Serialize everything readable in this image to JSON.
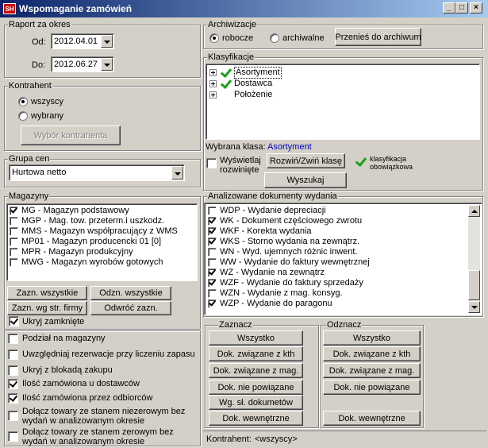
{
  "window": {
    "title": "Wspomaganie zamówień",
    "icon_text": "SH"
  },
  "raport": {
    "title": "Raport za okres",
    "od_label": "Od:",
    "od_value": "2012.04.01",
    "do_label": "Do:",
    "do_value": "2012.06.27"
  },
  "kontrahent": {
    "title": "Kontrahent",
    "opt_all": "wszyscy",
    "opt_sel": "wybrany",
    "btn_wybor": "Wybór kontrahenta"
  },
  "grupa_cen": {
    "title": "Grupa cen",
    "value": "Hurtowa netto"
  },
  "magazyny": {
    "title": "Magazyny",
    "items": [
      {
        "label": "MG - Magazyn podstawowy",
        "checked": true
      },
      {
        "label": "MGP - Mag. tow. przeterm.i uszkodz.",
        "checked": false
      },
      {
        "label": "MMS - Magazyn współpracujący z WMS",
        "checked": false
      },
      {
        "label": "MP01 - Magazyn producencki 01 [0]",
        "checked": false
      },
      {
        "label": "MPR - Magazyn produkcyjny",
        "checked": false
      },
      {
        "label": "MWG - Magazyn wyrobów gotowych",
        "checked": false
      }
    ],
    "btn_zazn_all": "Zazn. wszystkie",
    "btn_odzn_all": "Odzn. wszystkie",
    "btn_zazn_firmy": "Zazn. wg str. firmy",
    "btn_odwroc": "Odwróć zazn.",
    "ukryj_zamkniete": "Ukryj zamknięte"
  },
  "options": [
    {
      "label": "Podział na magazyny",
      "checked": false
    },
    {
      "label": "Uwzględniaj rezerwacje przy liczeniu zapasu",
      "checked": false
    },
    {
      "label": "Ukryj z blokadą zakupu",
      "checked": false
    },
    {
      "label": "Ilość zamówiona u dostawców",
      "checked": true
    },
    {
      "label": "Ilość zamówiona przez odbiorców",
      "checked": true
    },
    {
      "label": "Dołącz towary ze stanem niezerowym bez wydań w analizowanym okresie",
      "checked": false
    },
    {
      "label": "Dołącz towary ze stanem zerowym bez wydań w analizowanym okresie",
      "checked": false
    }
  ],
  "archiwizacje": {
    "title": "Archiwizacje",
    "opt_robocze": "robocze",
    "opt_archiwalne": "archiwalne",
    "btn_przenies": "Przenieś do archiwum"
  },
  "klasyfikacje": {
    "title": "Klasyfikacje",
    "items": [
      {
        "label": "Asortyment",
        "checked": true,
        "selected": true
      },
      {
        "label": "Dostawca",
        "checked": true,
        "selected": false
      },
      {
        "label": "Położenie",
        "checked": false,
        "selected": false
      }
    ],
    "wybrana_label": "Wybrana klasa:",
    "wybrana_value": "Asortyment",
    "wyswietlaj": "Wyświetlaj rozwinięte",
    "btn_rozwin": "Rozwiń/Zwiń klasę",
    "obowiazkowa": "klasyfikacja obowiązkowa",
    "btn_wyszukaj": "Wyszukaj"
  },
  "dokumenty": {
    "title": "Analizowane dokumenty wydania",
    "items": [
      {
        "label": "WDP - Wydanie depreciacji",
        "checked": false
      },
      {
        "label": "WK - Dokument częściowego zwrotu",
        "checked": true
      },
      {
        "label": "WKF - Korekta wydania",
        "checked": true
      },
      {
        "label": "WKS - Storno wydania na zewnątrz.",
        "checked": true
      },
      {
        "label": "WN - Wyd. ujemnych różnic inwent.",
        "checked": false
      },
      {
        "label": "WW - Wydanie do faktury wewnętrznej",
        "checked": false
      },
      {
        "label": "WZ - Wydanie na zewnątrz",
        "checked": true
      },
      {
        "label": "WZF - Wydanie do faktury sprzedaży",
        "checked": true
      },
      {
        "label": "WZN - Wydanie z mag. konsyg.",
        "checked": false
      },
      {
        "label": "WZP - Wydanie do paragonu",
        "checked": true
      }
    ]
  },
  "zaznacz": {
    "title": "Zaznacz",
    "buttons": [
      "Wszystko",
      "Dok. związane z kth",
      "Dok. związane z mag.",
      "Dok. nie powiązane",
      "Wg. sł. dokumetów",
      "Dok. wewnętrzne"
    ]
  },
  "odznacz": {
    "title": "Odznacz",
    "buttons": [
      "Wszystko",
      "Dok. związane z kth",
      "Dok. związane z mag.",
      "Dok. nie powiązane",
      "Dok. wewnętrzne"
    ]
  },
  "status": {
    "label": "Kontrahent:",
    "value": "<wszyscy>"
  }
}
